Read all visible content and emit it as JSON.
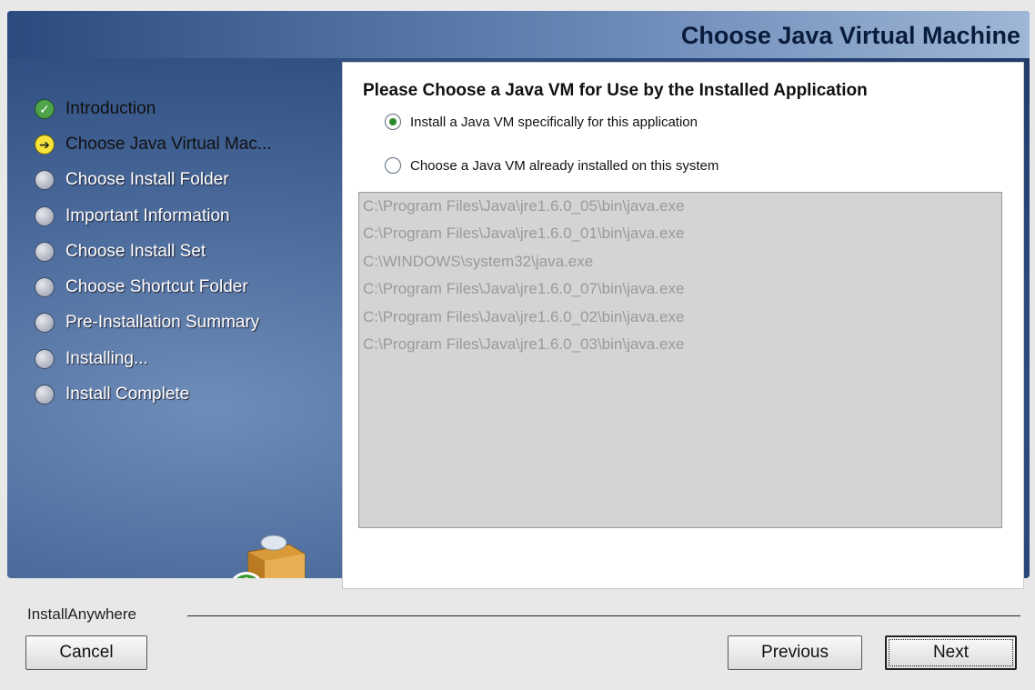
{
  "window": {
    "title": "Choose Java Virtual Machine"
  },
  "steps": [
    {
      "label": "Introduction",
      "state": "done"
    },
    {
      "label": "Choose Java Virtual Mac...",
      "state": "current"
    },
    {
      "label": "Choose Install Folder",
      "state": "pending"
    },
    {
      "label": "Important Information",
      "state": "pending"
    },
    {
      "label": "Choose Install Set",
      "state": "pending"
    },
    {
      "label": "Choose Shortcut Folder",
      "state": "pending"
    },
    {
      "label": "Pre-Installation Summary",
      "state": "pending"
    },
    {
      "label": "Installing...",
      "state": "pending"
    },
    {
      "label": "Install Complete",
      "state": "pending"
    }
  ],
  "content": {
    "heading": "Please Choose a Java VM for Use by the Installed Application",
    "option_install": "Install a Java VM specifically for this application",
    "option_choose": "Choose a Java VM already installed on this system",
    "selected_option": "install",
    "vm_list": [
      "C:\\Program Files\\Java\\jre1.6.0_05\\bin\\java.exe",
      "C:\\Program Files\\Java\\jre1.6.0_01\\bin\\java.exe",
      "C:\\WINDOWS\\system32\\java.exe",
      "C:\\Program Files\\Java\\jre1.6.0_07\\bin\\java.exe",
      "C:\\Program Files\\Java\\jre1.6.0_02\\bin\\java.exe",
      "C:\\Program Files\\Java\\jre1.6.0_03\\bin\\java.exe"
    ]
  },
  "footer": {
    "brand": "InstallAnywhere",
    "cancel_label": "Cancel",
    "previous_label": "Previous",
    "next_label": "Next"
  },
  "colors": {
    "banner_dark": "#1e3766",
    "banner_light": "#6f8db8",
    "done_bullet": "#4fa34a",
    "current_bullet": "#f7e33a",
    "selected_radio": "#2b8a2b"
  }
}
